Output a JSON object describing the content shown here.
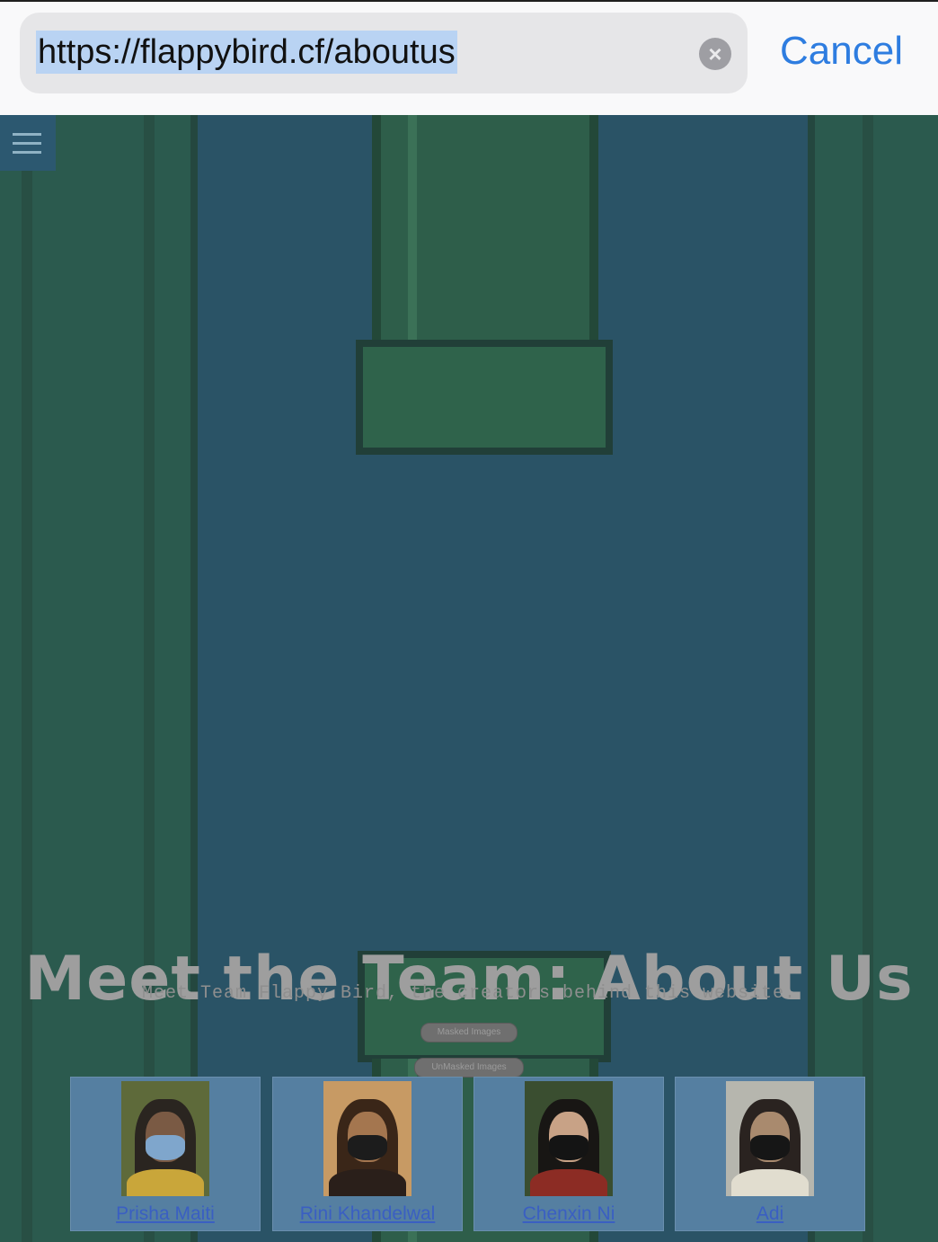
{
  "browser": {
    "url": "https://flappybird.cf/aboutus",
    "cancel_label": "Cancel"
  },
  "page": {
    "title": "Meet the Team: About Us",
    "subtitle": "Meet Team Flappy Bird, the creators behind this website.",
    "masked_button_label": "Masked Images",
    "unmasked_button_label": "UnMasked Images",
    "team": [
      {
        "name": "Prisha Maiti"
      },
      {
        "name": "Rini Khandelwal"
      },
      {
        "name": "Chenxin Ni"
      },
      {
        "name": "Adi"
      }
    ]
  },
  "icons": {
    "menu": "hamburger-icon",
    "clear": "clear-x-icon"
  },
  "colors": {
    "link": "#3a5fc2",
    "cancel": "#2e7de0",
    "url_highlight": "#b9d3f3"
  }
}
